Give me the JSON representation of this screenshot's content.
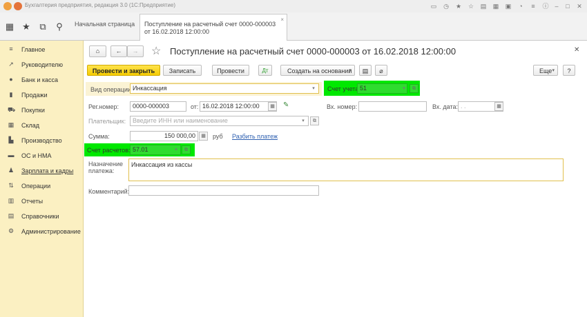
{
  "window": {
    "title": "Бухгалтерия предприятия, редакция 3.0  (1С:Предприятие)"
  },
  "tabs": {
    "home_label": "Начальная страница",
    "doc_label_line1": "Поступление на расчетный счет 0000-000003",
    "doc_label_line2": "от 16.02.2018 12:00:00",
    "close": "×"
  },
  "sidebar": {
    "items": [
      {
        "label": "Главное",
        "icon": "menu-icon"
      },
      {
        "label": "Руководителю",
        "icon": "trend-icon"
      },
      {
        "label": "Банк и касса",
        "icon": "coin-icon"
      },
      {
        "label": "Продажи",
        "icon": "bag-icon"
      },
      {
        "label": "Покупки",
        "icon": "cart-icon"
      },
      {
        "label": "Склад",
        "icon": "warehouse-icon"
      },
      {
        "label": "Производство",
        "icon": "factory-icon"
      },
      {
        "label": "ОС и НМА",
        "icon": "truck-icon"
      },
      {
        "label": "Зарплата и кадры",
        "icon": "person-icon"
      },
      {
        "label": "Операции",
        "icon": "operations-icon"
      },
      {
        "label": "Отчеты",
        "icon": "chart-icon"
      },
      {
        "label": "Справочники",
        "icon": "book-icon"
      },
      {
        "label": "Администрирование",
        "icon": "gear-icon"
      }
    ]
  },
  "document": {
    "title": "Поступление на расчетный счет 0000-000003 от 16.02.2018 12:00:00"
  },
  "commands": {
    "post_and_close": "Провести и закрыть",
    "save": "Записать",
    "post": "Провести",
    "create_based_on": "Создать на основании",
    "more": "Еще",
    "help": "?"
  },
  "form": {
    "operation_label": "Вид операции:",
    "operation_value": "Инкассация",
    "account_label": "Счет учета:",
    "account_value": "51",
    "reg_number_label": "Рег.номер:",
    "reg_number_value": "0000-000003",
    "date_from_label": "от:",
    "date_value": "16.02.2018 12:00:00",
    "in_number_label": "Вх. номер:",
    "in_number_value": "",
    "in_date_label": "Вх. дата:",
    "in_date_value": " .  .",
    "payer_label": "Плательщик:",
    "payer_placeholder": "Введите ИНН или наименование",
    "sum_label": "Сумма:",
    "sum_value": "150 000,00",
    "currency": "руб",
    "split_payment": "Разбить платеж",
    "settlement_account_label": "Счет расчетов:",
    "settlement_account_value": "57.01",
    "purpose_label_line1": "Назначение",
    "purpose_label_line2": "платежа:",
    "purpose_value": "Инкассация из кассы",
    "comment_label": "Комментарий:",
    "comment_value": ""
  },
  "colors": {
    "sidebar_bg": "#fbf0c2",
    "primary_button": "#f5cc00",
    "highlight": "#00e800",
    "link": "#2d5fb0"
  }
}
